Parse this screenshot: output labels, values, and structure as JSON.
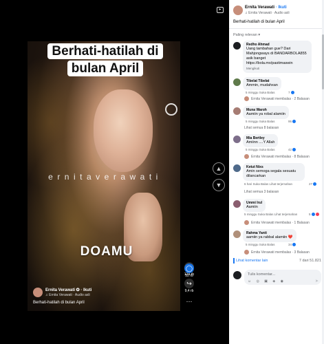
{
  "video": {
    "headline_line1": "Berhati-hatilah di",
    "headline_line2": "bulan April",
    "watermark": "ernitaverawati",
    "overlay_text": "DOAMU",
    "author_name": "Ernita Verawati ✪ · Ikuti",
    "author_audio": "♫ Ernita Verawati · Audio asli",
    "caption": "Berhati-hatilah di bulan April",
    "like_count": "124 rb",
    "comment_count": "52 rb",
    "share_count": "9,4 rb",
    "more_icon": "⋯",
    "up_icon": "▲",
    "down_icon": "▼"
  },
  "panel": {
    "author_name": "Ernita Verawati",
    "follow_label": "· Ikuti",
    "audio": "♫ Ernita Verawati · Audio asli",
    "caption": "Berhati-hatilah di bulan April",
    "sort_label": "Paling relevan ▾",
    "comments": [
      {
        "name": "Redho Ahmad",
        "text": "Uang tambahan gue? Dari Mahjongways di BANDARBOLA855 asik banget https://bola.mx/pastimaswin",
        "meta": "Mengikuti",
        "reacts": "",
        "reply": "",
        "seeall": ""
      },
      {
        "name": "Tibelat Tibelat",
        "text": "Ammin, mudahxan",
        "meta": "5 minggu   Suka   Balas",
        "reacts": "7",
        "reply": "",
        "seeall": ""
      },
      {
        "name": "Muna Waroh",
        "text": "Aamiin ya robal alamiin",
        "meta": "5 minggu   Suka   Balas",
        "reacts": "95",
        "reply": "",
        "seeall": "Lihat semua 8 balasan"
      },
      {
        "name": "Mia Bertley",
        "text": "Amiinn ....Y Allah",
        "meta": "5 minggu   Suka   Balas",
        "reacts": "42",
        "reply": "Ernita Verawati membalas · 8 Balasan",
        "seeall": ""
      },
      {
        "name": "Ketut Nixs",
        "text": "Amin semoga segala sesuatu dilancarkan",
        "meta": "6 hari   Suka   Balas   Lihat terjemahan",
        "reacts": "27",
        "reply": "",
        "seeall": "Lihat semua 3 balasan"
      },
      {
        "name": "Ummi Irul",
        "text": "Aamiin",
        "meta": "5 minggu   Suka   Balas   Lihat terjemahan",
        "reacts": "5",
        "reply": "Ernita Verawati membalas · 1 Balasan",
        "seeall": ""
      },
      {
        "name": "Rahma Yanti",
        "text": "aamiin ya rabbal alamiin ❤️",
        "meta": "5 minggu   Suka   Balas",
        "reacts": "34",
        "reply": "Ernita Verawati membalas · 3 Balasan",
        "seeall": ""
      }
    ],
    "more_comments": "Lihat komentar lain",
    "more_count": "7 dari 51.821",
    "compose_placeholder": "Tulis komentar...",
    "compose_icons": "☺ ◎ ▣ ◈ ◉",
    "send_icon": "➤",
    "top_reply": "Ernita Verawati membalas · 2 Balasan"
  },
  "colors": {
    "accent": "#1877f2",
    "panel_bg": "#ffffff",
    "bubble": "#f0f2f5"
  }
}
